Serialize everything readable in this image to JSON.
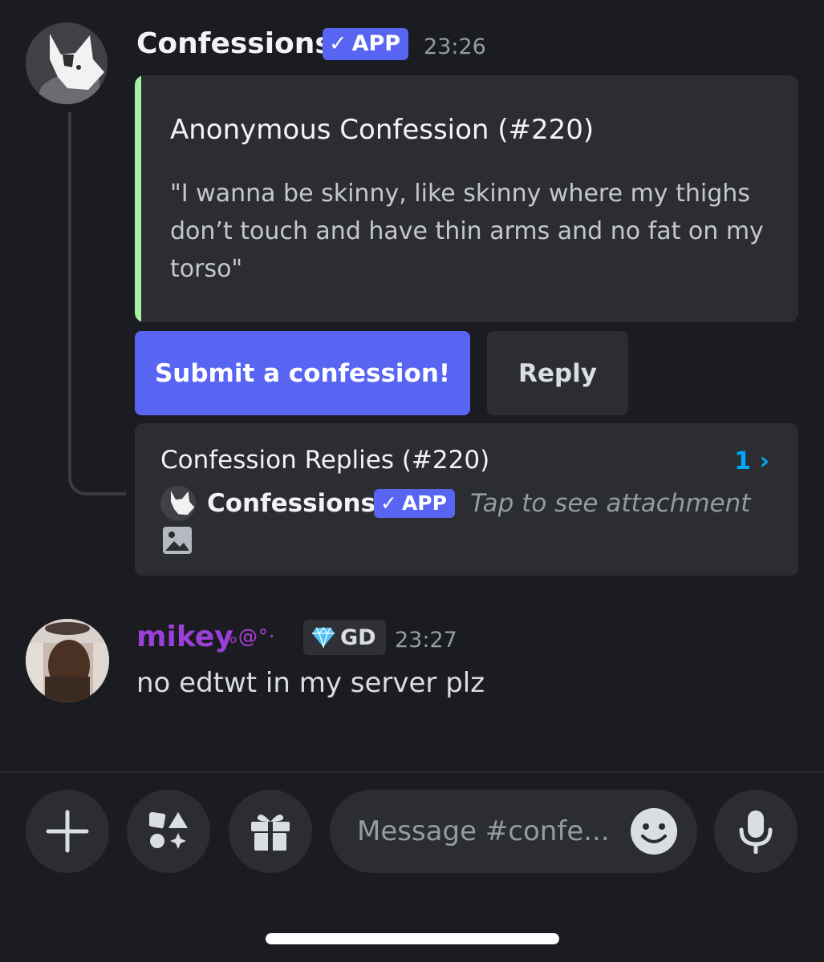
{
  "message_1": {
    "author": "Confessions",
    "badge": "APP",
    "timestamp": "23:26",
    "embed": {
      "title": "Anonymous Confession (#220)",
      "description": "\"I wanna be skinny, like skinny where my thighs don’t touch and have thin arms and no fat on my torso\"",
      "accent_color": "#a4f0a0"
    },
    "buttons": {
      "primary": "Submit a confession!",
      "secondary": "Reply"
    },
    "thread": {
      "title": "Confession Replies (#220)",
      "count": "1",
      "count_suffix": "›",
      "last_author": "Confessions",
      "last_badge": "APP",
      "preview": "Tap to see attachment"
    }
  },
  "message_2": {
    "author": "mikey",
    "author_color": "#9b3fd8",
    "decoration": "ₒ@°·",
    "tag": "GD",
    "timestamp": "23:27",
    "text": "no edtwt in my server plz"
  },
  "composer": {
    "placeholder": "Message #confe..."
  },
  "icons": {
    "add": "plus-icon",
    "apps": "apps-icon",
    "gift": "gift-icon",
    "emoji": "emoji-icon",
    "mic": "microphone-icon",
    "image": "image-icon",
    "check": "checkmark-icon",
    "gem": "diamond-icon"
  },
  "colors": {
    "background": "#1b1c21",
    "blurple": "#5865f2",
    "link": "#00a8fc"
  }
}
